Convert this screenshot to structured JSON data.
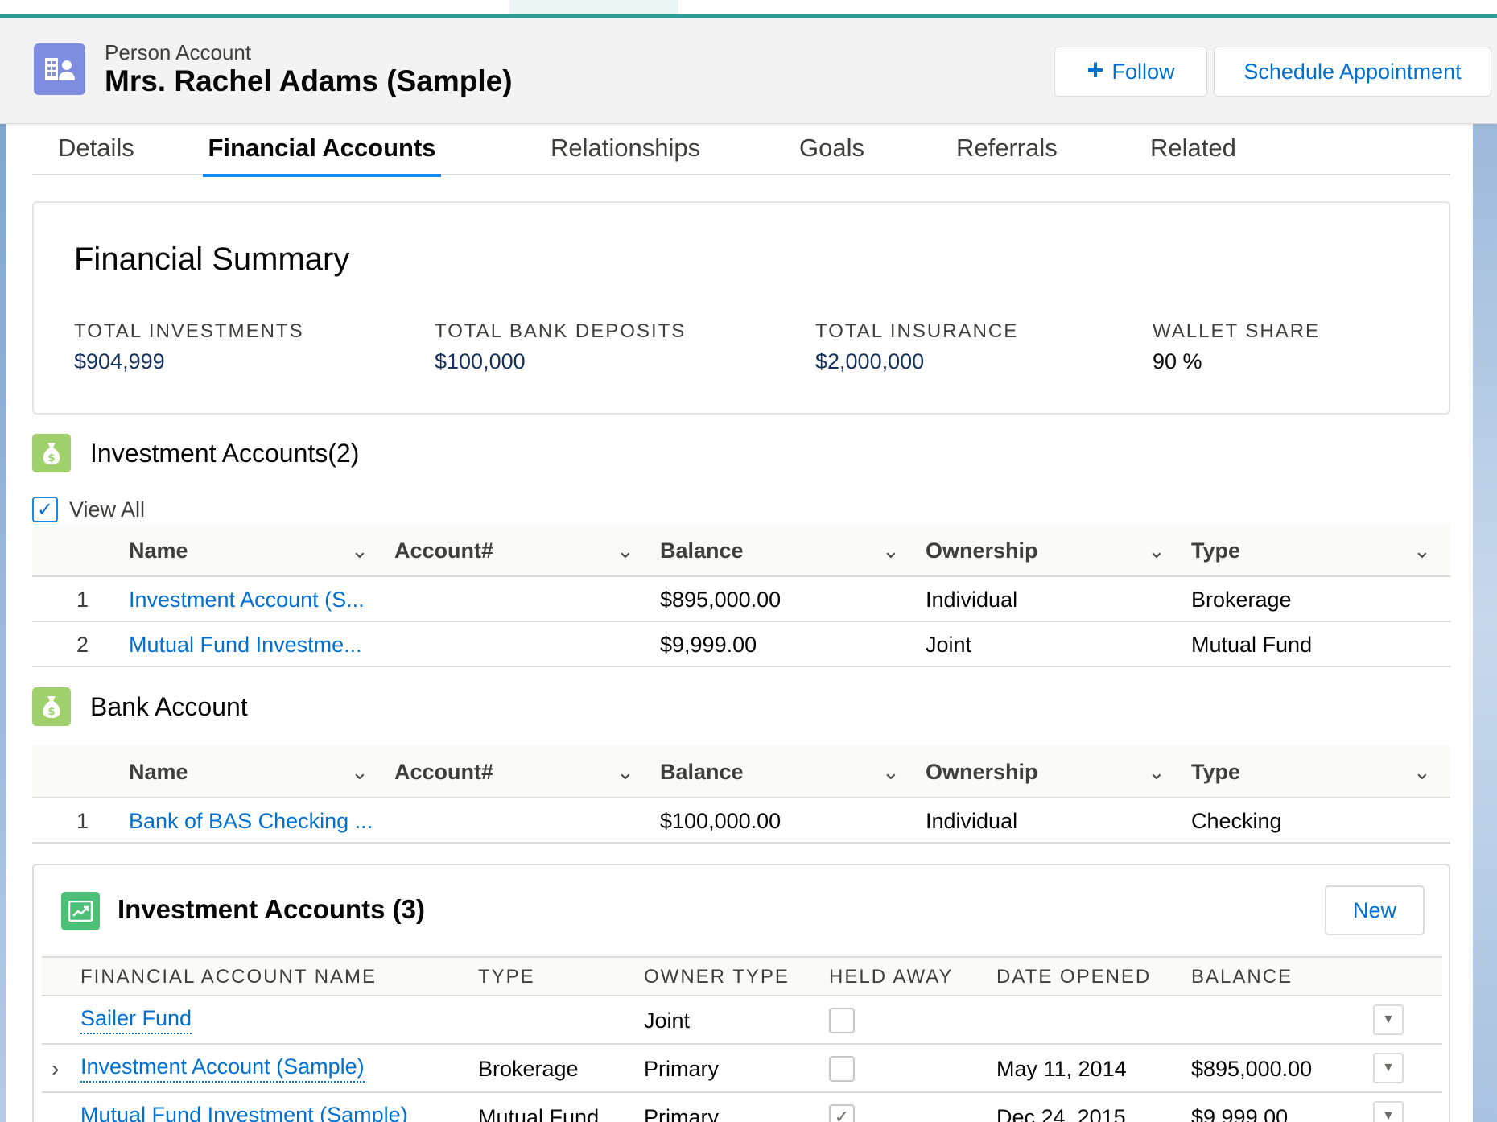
{
  "header": {
    "object_type": "Person Account",
    "record_name": "Mrs. Rachel Adams (Sample)",
    "follow_label": "Follow",
    "schedule_label": "Schedule Appointment"
  },
  "tabs": [
    {
      "label": "Details"
    },
    {
      "label": "Financial Accounts"
    },
    {
      "label": "Relationships"
    },
    {
      "label": "Goals"
    },
    {
      "label": "Referrals"
    },
    {
      "label": "Related"
    }
  ],
  "summary": {
    "title": "Financial Summary",
    "stats": [
      {
        "label": "TOTAL INVESTMENTS",
        "value": "$904,999"
      },
      {
        "label": "TOTAL BANK DEPOSITS",
        "value": "$100,000"
      },
      {
        "label": "TOTAL INSURANCE",
        "value": "$2,000,000"
      },
      {
        "label": "WALLET SHARE",
        "value": "90 %"
      }
    ]
  },
  "investment_section": {
    "title": "Investment Accounts(2)",
    "view_all_label": "View All",
    "columns": [
      "Name",
      "Account#",
      "Balance",
      "Ownership",
      "Type"
    ],
    "rows": [
      {
        "num": "1",
        "name": "Investment Account (S...",
        "account": "",
        "balance": "$895,000.00",
        "ownership": "Individual",
        "type": "Brokerage"
      },
      {
        "num": "2",
        "name": "Mutual Fund Investme...",
        "account": "",
        "balance": "$9,999.00",
        "ownership": "Joint",
        "type": "Mutual Fund"
      }
    ]
  },
  "bank_section": {
    "title": "Bank Account",
    "columns": [
      "Name",
      "Account#",
      "Balance",
      "Ownership",
      "Type"
    ],
    "rows": [
      {
        "num": "1",
        "name": "Bank of BAS Checking ...",
        "account": "",
        "balance": "$100,000.00",
        "ownership": "Individual",
        "type": "Checking"
      }
    ]
  },
  "related_list": {
    "title": "Investment Accounts (3)",
    "new_label": "New",
    "columns": [
      "FINANCIAL ACCOUNT NAME",
      "TYPE",
      "OWNER TYPE",
      "HELD AWAY",
      "DATE OPENED",
      "BALANCE"
    ],
    "rows": [
      {
        "name": "Sailer Fund",
        "type": "",
        "owner_type": "Joint",
        "held_away": false,
        "date_opened": "",
        "balance": ""
      },
      {
        "name": "Investment Account (Sample)",
        "type": "Brokerage",
        "owner_type": "Primary",
        "held_away": false,
        "date_opened": "May 11, 2014",
        "balance": "$895,000.00"
      },
      {
        "name": "Mutual Fund Investment (Sample)",
        "type": "Mutual Fund",
        "owner_type": "Primary",
        "held_away": true,
        "date_opened": "Dec 24, 2015",
        "balance": "$9,999.00"
      }
    ]
  },
  "colors": {
    "brand_blue": "#0070d2",
    "active_tab": "#1589ee",
    "person_icon": "#7f8de1",
    "money_icon": "#a0d06b",
    "chart_icon": "#4bc076",
    "value_navy": "#16325c"
  },
  "icons": {
    "record": "person-account-icon",
    "plus": "plus-icon",
    "money": "money-bag-icon",
    "chart": "line-chart-icon",
    "chevron": "chevron-down-icon",
    "row_menu": "down-triangle-icon",
    "expander": "chevron-right-icon"
  }
}
